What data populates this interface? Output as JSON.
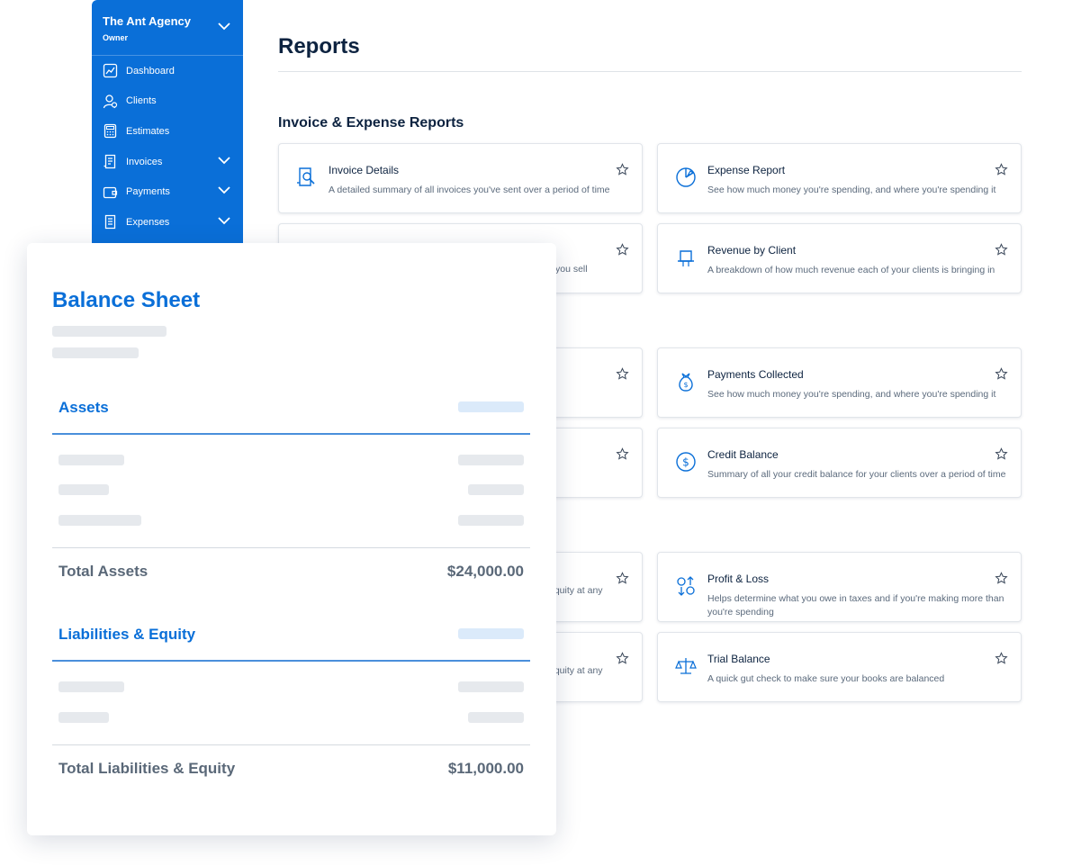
{
  "sidebar": {
    "org_name": "The Ant Agency",
    "role": "Owner",
    "items": [
      {
        "label": "Dashboard",
        "icon": "chart-icon"
      },
      {
        "label": "Clients",
        "icon": "user-icon"
      },
      {
        "label": "Estimates",
        "icon": "calculator-icon"
      },
      {
        "label": "Invoices",
        "icon": "invoice-icon"
      },
      {
        "label": "Payments",
        "icon": "wallet-icon"
      },
      {
        "label": "Expenses",
        "icon": "receipt-icon"
      }
    ]
  },
  "main": {
    "title": "Reports",
    "section_invoice_expense": "Invoice & Expense Reports",
    "cards": {
      "invoice_details": {
        "title": "Invoice Details",
        "desc": "A detailed summary of all invoices you've sent over a period of time"
      },
      "expense_report": {
        "title": "Expense Report",
        "desc": "See how much money you're spending, and where you're spending it"
      },
      "partial_left_1": {
        "desc_fragment": "you sell"
      },
      "revenue_by_client": {
        "title": "Revenue by Client",
        "desc": "A breakdown of how much revenue each of your clients is bringing in"
      },
      "payments_collected": {
        "title": "Payments Collected",
        "desc": "See how much money you're spending, and where you're spending it"
      },
      "credit_balance": {
        "title": "Credit Balance",
        "desc": "Summary of all your credit balance for your clients over a period of time"
      },
      "partial_left_2": {
        "desc_fragment": "equity at any"
      },
      "profit_loss": {
        "title": "Profit & Loss",
        "desc": "Helps determine what you owe in taxes and if you're making more than you're spending"
      },
      "partial_left_3": {
        "desc_fragment": "equity at any"
      },
      "trial_balance": {
        "title": "Trial Balance",
        "desc": "A quick gut check to make sure your books are balanced"
      }
    }
  },
  "balance_sheet": {
    "title": "Balance Sheet",
    "assets_label": "Assets",
    "total_assets_label": "Total Assets",
    "total_assets_value": "$24,000.00",
    "liabilities_label": "Liabilities & Equity",
    "total_liabilities_label": "Total Liabilities & Equity",
    "total_liabilities_value": "$11,000.00"
  },
  "colors": {
    "brand_blue": "#0a6fd8",
    "text_dark": "#0d2340",
    "text_muted": "#5b6a7c",
    "placeholder": "#e6e9ed"
  }
}
